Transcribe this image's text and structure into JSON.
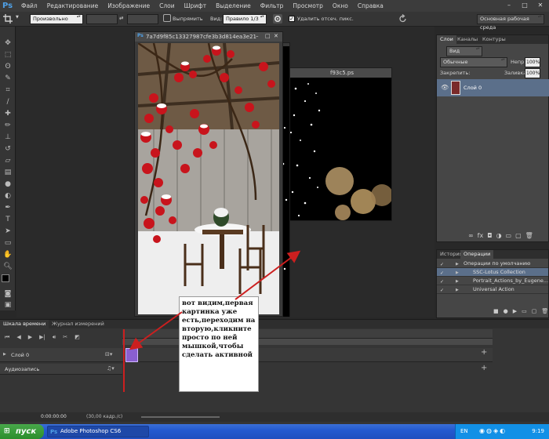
{
  "menubar": {
    "logo": "Ps",
    "items": [
      "Файл",
      "Редактирование",
      "Изображение",
      "Слои",
      "Шрифт",
      "Выделение",
      "Фильтр",
      "Просмотр",
      "Окно",
      "Справка"
    ],
    "controls": [
      "–",
      "□",
      "✕"
    ]
  },
  "options_bar": {
    "style_value": "Произвольно",
    "swap_label": "⇄",
    "straighten_label": "Выпрямить",
    "view_label": "Вид:",
    "view_value": "Правило 1/3",
    "delete_cropped_label": "Удалить отсеч. пикс.",
    "workspace_value": "Основная рабочая среда",
    "delete_cropped_checked": true
  },
  "document": {
    "title": "7a7d9f85c13327987cfe3b3d814ea3e21",
    "second_title": "f93c5.ps"
  },
  "layers_panel": {
    "tabs": [
      "Слои",
      "Каналы",
      "Контуры"
    ],
    "kind_value": "Вид",
    "blend_value": "Обычные",
    "opacity_label": "Непр:",
    "opacity_value": "100%",
    "lock_label": "Закрепить:",
    "fill_label": "Заливка:",
    "fill_value": "100%",
    "layer_name": "Слой 0"
  },
  "actions_panel": {
    "tabs": [
      "История",
      "Операции"
    ],
    "items": [
      "Операции по умолчанию",
      "SSC-Lotus Collection",
      "Portrait_Actions_by_Eugene...",
      "Universal Action"
    ]
  },
  "timeline": {
    "tabs": [
      "Шкала времени",
      "Журнал измерений"
    ],
    "track_label": "Слой 0",
    "audio_label": "Аудиозапись",
    "timecode": "0:00:00:00",
    "fps": "(30,00 кадр./с)"
  },
  "annotation": {
    "text": "вот видим,первая картинка уже есть,переходим на вторую,кликните просто по ней мышкой,чтобы сделать активной"
  },
  "taskbar": {
    "start_label": "пуск",
    "task_label": "Adobe Photoshop CS6",
    "lang": "EN",
    "clock": "9:19"
  },
  "colors": {
    "accent_red": "#cc1f1f",
    "clip_purple": "#8a5fd0",
    "ps_blue": "#4fa0e6"
  }
}
